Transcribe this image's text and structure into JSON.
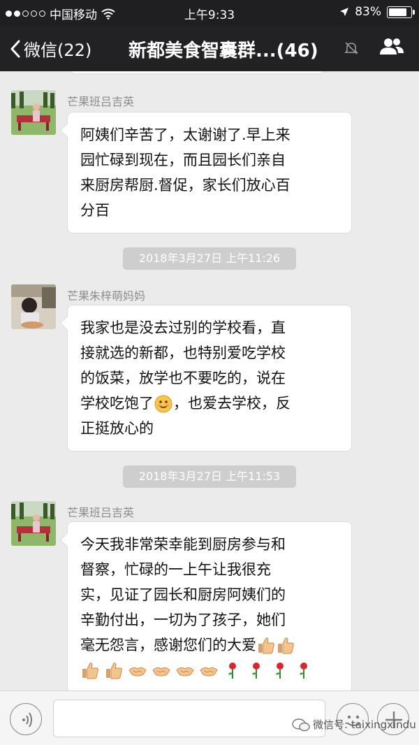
{
  "status": {
    "carrier": "中国移动",
    "time": "上午9:33",
    "battery": "83%",
    "battery_level": 0.83
  },
  "nav": {
    "back_label": "微信(22)",
    "title": "新都美食智囊群...(46)"
  },
  "messages": [
    {
      "sender": "芒果班吕吉英",
      "lines": [
        "阿姨们辛苦了，太谢谢了.早上来",
        "园忙碌到现在，而且园长们亲自",
        "来厨房帮厨.督促，家长们放心百",
        "分百"
      ]
    },
    {
      "sender": "芒果朱梓萌妈妈",
      "lines": [
        "我家也是没去过别的学校看，直",
        "接就选的新都，也特别爱吃学校",
        "的饭菜，放学也不要吃的，说在"
      ],
      "line4_before": "学校吃饱了",
      "line4_after": "，也爱去学校，反",
      "line5": "正挺放心的"
    },
    {
      "sender": "芒果班吕吉英",
      "lines": [
        "今天我非常荣幸能到厨房参与和",
        "督察，忙碌的一上午让我很充",
        "实，见证了园长和厨房阿姨们的",
        "辛勤付出，一切为了孩子，她们"
      ],
      "line5": "毫无怨言，感谢您们的大爱"
    }
  ],
  "timestamps": [
    "2018年3月27日 上午11:26",
    "2018年3月27日 上午11:53"
  ],
  "watermark": "微信号: taixingxindu",
  "icons": {
    "wifi": "wifi-icon",
    "location": "location-arrow-icon",
    "mute": "mute-bell-icon",
    "people": "group-members-icon",
    "smile": "smile-emoji",
    "thumb": "thumbs-up-emoji",
    "shake": "handshake-emoji",
    "rose": "rose-emoji"
  },
  "colors": {
    "navbar": "#222224",
    "chat_bg": "#ebebeb",
    "bubble": "#ffffff",
    "sender": "#8d8d8d",
    "timestamp_bg": "#cecece"
  }
}
